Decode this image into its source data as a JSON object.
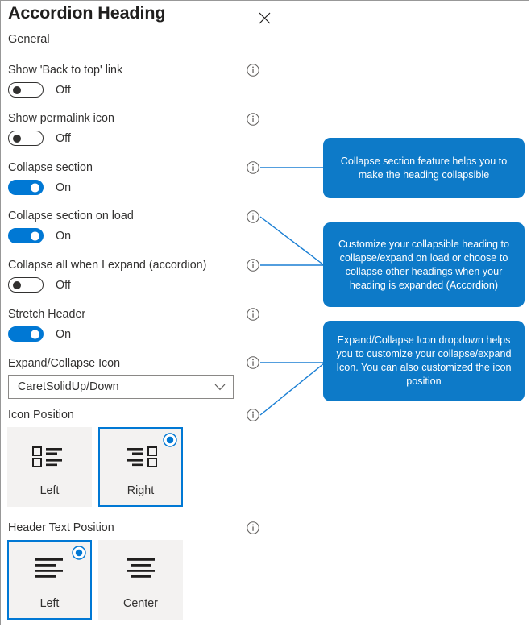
{
  "panel": {
    "title": "Accordion Heading",
    "close_icon": "close-icon",
    "section_label": "General",
    "accent_color": "#0078d4",
    "callout_color": "#0d7ac8",
    "tile_bg_color": "#f3f2f1"
  },
  "settings": [
    {
      "label": "Show 'Back to top' link",
      "state": "Off",
      "on": false
    },
    {
      "label": "Show permalink icon",
      "state": "Off",
      "on": false
    },
    {
      "label": "Collapse section",
      "state": "On",
      "on": true
    },
    {
      "label": "Collapse section on load",
      "state": "On",
      "on": true
    },
    {
      "label": "Collapse all when I expand (accordion)",
      "state": "Off",
      "on": false
    },
    {
      "label": "Stretch Header",
      "state": "On",
      "on": true
    }
  ],
  "dropdown": {
    "label": "Expand/Collapse Icon",
    "value": "CaretSolidUp/Down",
    "chevron_icon": "chevron-down-icon"
  },
  "icon_position": {
    "label": "Icon Position",
    "options": [
      {
        "caption": "Left",
        "selected": false,
        "glyph": "list-icon-left"
      },
      {
        "caption": "Right",
        "selected": true,
        "glyph": "list-icon-right"
      }
    ]
  },
  "header_text_position": {
    "label": "Header Text Position",
    "options": [
      {
        "caption": "Left",
        "selected": true,
        "glyph": "align-left-icon"
      },
      {
        "caption": "Center",
        "selected": false,
        "glyph": "align-center-icon"
      }
    ]
  },
  "info_icons": [
    {
      "name": "info-icon-back-to-top"
    },
    {
      "name": "info-icon-permalink"
    },
    {
      "name": "info-icon-collapse-section"
    },
    {
      "name": "info-icon-collapse-on-load"
    },
    {
      "name": "info-icon-collapse-all"
    },
    {
      "name": "info-icon-stretch-header"
    },
    {
      "name": "info-icon-expand-collapse-icon"
    },
    {
      "name": "info-icon-icon-position"
    },
    {
      "name": "info-icon-header-text-position"
    }
  ],
  "callouts": [
    {
      "text": "Collapse section feature helps you to make the heading collapsible"
    },
    {
      "text": "Customize your collapsible heading to collapse/expand on load or choose to collapse other headings when your heading is expanded (Accordion)"
    },
    {
      "text": "Expand/Collapse Icon dropdown helps you to customize your collapse/expand Icon. You can also customized the icon position"
    }
  ]
}
